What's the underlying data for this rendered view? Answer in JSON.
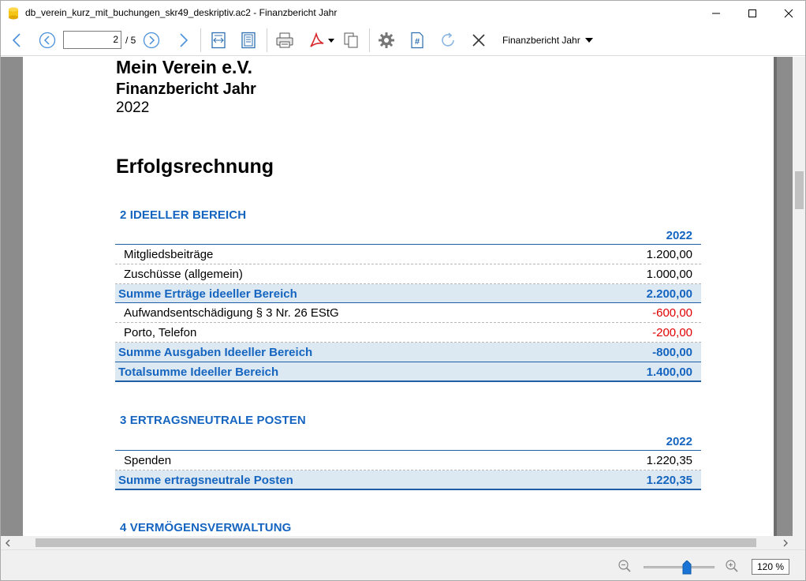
{
  "window": {
    "title": "db_verein_kurz_mit_buchungen_skr49_deskriptiv.ac2 - Finanzbericht Jahr"
  },
  "toolbar": {
    "page_current": "2",
    "page_total": "/ 5",
    "report_selector": "Finanzbericht Jahr"
  },
  "report": {
    "organization": "Mein Verein e.V.",
    "title": "Finanzbericht Jahr",
    "year": "2022",
    "section": "Erfolgsrechnung",
    "groups": [
      {
        "title": "2 IDEELLER BEREICH",
        "column": "2022",
        "rows": [
          {
            "label": "Mitgliedsbeiträge",
            "value": "1.200,00",
            "type": "item"
          },
          {
            "label": "Zuschüsse (allgemein)",
            "value": "1.000,00",
            "type": "item"
          },
          {
            "label": "Summe Erträge ideeller Bereich",
            "value": "2.200,00",
            "type": "sum"
          },
          {
            "label": "Aufwandsentschädigung § 3 Nr. 26 EStG",
            "value": "-600,00",
            "type": "item"
          },
          {
            "label": "Porto, Telefon",
            "value": "-200,00",
            "type": "item"
          },
          {
            "label": "Summe Ausgaben Ideeller Bereich",
            "value": "-800,00",
            "type": "sum"
          },
          {
            "label": "Totalsumme Ideeller Bereich",
            "value": "1.400,00",
            "type": "total"
          }
        ]
      },
      {
        "title": "3 ERTRAGSNEUTRALE POSTEN",
        "column": "2022",
        "rows": [
          {
            "label": "Spenden",
            "value": "1.220,35",
            "type": "item"
          },
          {
            "label": "Summe ertragsneutrale Posten",
            "value": "1.220,35",
            "type": "total"
          }
        ]
      },
      {
        "title": "4 VERMÖGENSVERWALTUNG"
      }
    ]
  },
  "statusbar": {
    "zoom": "120 %",
    "zoom_level": 120
  },
  "colors": {
    "accent": "#1565c0",
    "negative": "#e00000",
    "sum_row_bg": "#dde9f2"
  }
}
